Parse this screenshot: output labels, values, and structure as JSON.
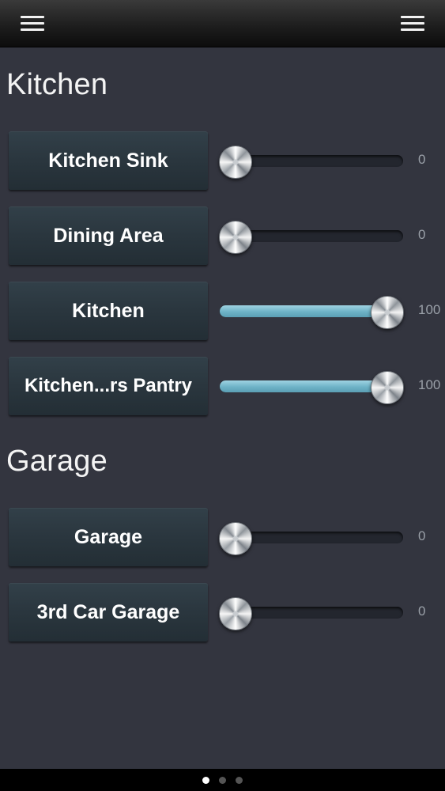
{
  "topbar": {
    "left_icon": "menu-icon",
    "right_icon": "menu-icon"
  },
  "sections": [
    {
      "title": "Kitchen",
      "devices": [
        {
          "label": "Kitchen Sink",
          "value": "0",
          "level": 0
        },
        {
          "label": "Dining Area",
          "value": "0",
          "level": 0
        },
        {
          "label": "Kitchen",
          "value": "100",
          "level": 100
        },
        {
          "label": "Kitchen...rs Pantry",
          "value": "100",
          "level": 100
        }
      ]
    },
    {
      "title": "Garage",
      "devices": [
        {
          "label": "Garage",
          "value": "0",
          "level": 0
        },
        {
          "label": "3rd Car Garage",
          "value": "0",
          "level": 0
        }
      ]
    }
  ],
  "pager": {
    "pages": 3,
    "active": 0
  },
  "colors": {
    "background": "#33353f",
    "slider_fill": "#6eb2c6",
    "button": "#2a363e",
    "value_text": "#9aa0a8"
  }
}
